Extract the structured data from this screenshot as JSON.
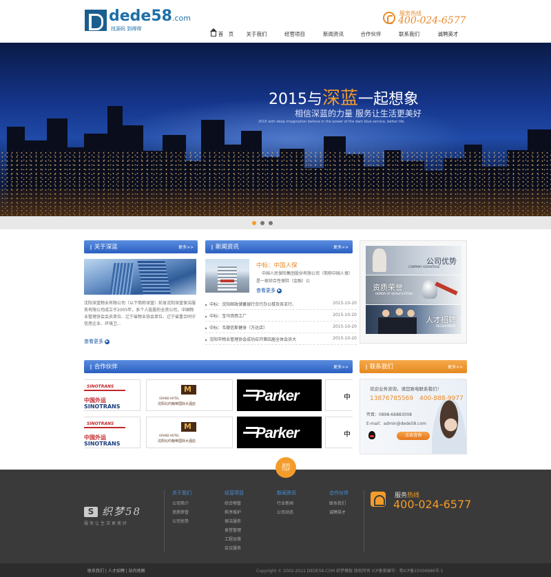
{
  "header": {
    "logo_text": "dede58",
    "logo_suffix": ".com",
    "logo_slogan": "找源码 到得得",
    "hotline_label": "服务热线",
    "hotline_number": "400-024-6577",
    "nav": [
      "首　页",
      "关于我们",
      "经营项目",
      "新闻资讯",
      "合作伙伴",
      "联系我们",
      "诚聘英才"
    ]
  },
  "banner": {
    "title_prefix": "2015与",
    "title_highlight": "深蓝",
    "title_suffix": "一起想象",
    "subtitle": "相信深蓝的力量  服务让生活更美好",
    "english": "2015 with deep imagination believe in the power of the dark blue service, better life",
    "active_slide": 1,
    "slide_count": 3
  },
  "about": {
    "title": "关于深蓝",
    "more": "更多>>",
    "text": "沈阳深蓝物业有限公司（以下简称深蓝）前身沈阳深蓝保洁服务有限公司成立于2005年，系个人投股的全资公司，中国物业管理协会会员单位、辽宁省物业协会单位、辽宁省重合同守信用企业、环境卫...",
    "more_link": "查看更多"
  },
  "news": {
    "title": "新闻资讯",
    "more": "更多>>",
    "headline": "中标：中国人保",
    "summary": "中国人民保险集团股份有限公司（简称中国人保）是一家综合性保险（金融）公",
    "more_link": "查看更多",
    "items": [
      {
        "title": "中标：沈阳邮政储蓄银行合行办公楼及各支行、",
        "date": "2015-10-20"
      },
      {
        "title": "中标：宝马铁西工厂",
        "date": "2015-10-20"
      },
      {
        "title": "中标：韦德信斯健身（万达店）",
        "date": "2015-10-20"
      },
      {
        "title": "沈阳市物业管理协会成功召开第四届全体会员大",
        "date": "2015-10-20"
      }
    ]
  },
  "promos": [
    {
      "zh": "公司优势",
      "en": "COMPANY ADVANTAGE"
    },
    {
      "zh": "资质荣誉",
      "en": "HONOR OF QUALIFICATION"
    },
    {
      "zh": "人才招聘",
      "en": "RECRUITMENT"
    }
  ],
  "partners": {
    "title": "合作伙伴",
    "more": "更多>>",
    "sino_small": "SINOTRANS",
    "sino_cn": "中国外运",
    "sino_en": "SINOTRANS",
    "hotel_en": "GRAND HOTEL",
    "hotel_cn": "沈阳北约翰帝国际大酒店",
    "parker": "Parker",
    "cut_glyph": "中"
  },
  "contact": {
    "title": "联系我们",
    "more": "更多>>",
    "welcome": "欢迎业务咨询，请您致电联系我们！",
    "phones": "13876785569　400-888-9977",
    "fax": "传真：0898-66883008",
    "email": "E-mail：admin@dede58.com",
    "button": "点击咨询"
  },
  "footer": {
    "top_a": "返回",
    "top_b": "TOP",
    "logo_s": "S",
    "logo_name": "织梦58",
    "logo_slogan": "服务让生活更美好",
    "columns": [
      {
        "title": "关于我们",
        "links": [
          "公司简介",
          "资质荣誉",
          "公司优势"
        ]
      },
      {
        "title": "经营项目",
        "links": [
          "综合物管",
          "秩序维护",
          "保洁服务",
          "食堂管理",
          "工程运维",
          "会议服务"
        ]
      },
      {
        "title": "新闻资讯",
        "links": [
          "行业新闻",
          "公司动态"
        ]
      },
      {
        "title": "合作伙伴",
        "links": [
          "联系我们",
          "诚聘英才"
        ]
      }
    ],
    "hot_label": "服务",
    "hot_label_accent": "热线",
    "hot_number": "400-024-6577",
    "copy_links": "联系我们  |  人才招聘  |  站内地图",
    "copyright": "Copyright © 2002-2011 DEDE58.COM 织梦模板 版权所有  ICP备案编号：粤ICP备15006986号-1"
  }
}
